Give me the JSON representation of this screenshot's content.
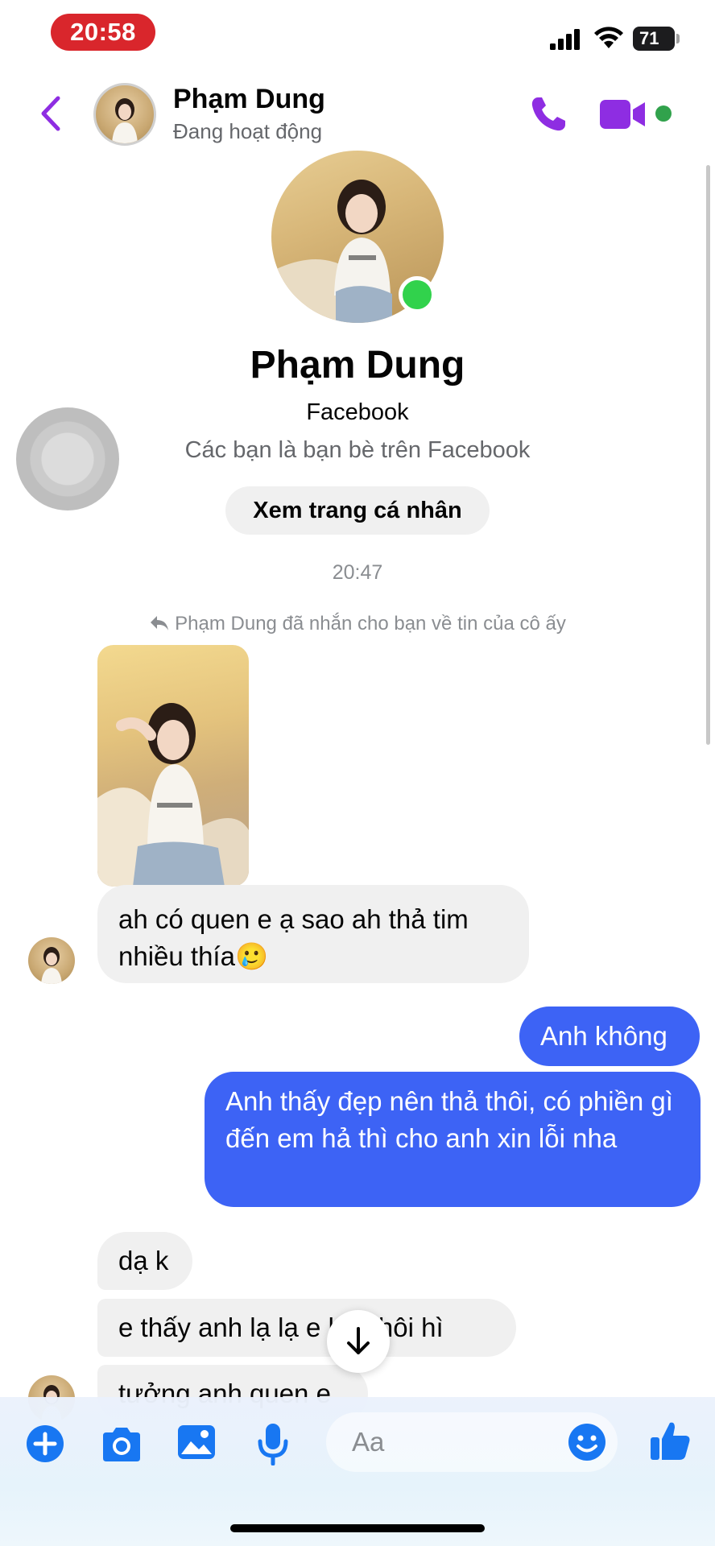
{
  "status_bar": {
    "time": "20:58",
    "battery": "71"
  },
  "header": {
    "name": "Phạm Dung",
    "status": "Đang hoạt động"
  },
  "profile": {
    "name": "Phạm Dung",
    "platform": "Facebook",
    "friends_text": "Các bạn là bạn bè trên Facebook",
    "view_profile_label": "Xem trang cá nhân"
  },
  "conversation": {
    "timestamp": "20:47",
    "story_reply_note": "Phạm Dung đã nhắn cho bạn về tin của cô ấy",
    "messages": [
      {
        "from": "them",
        "text": "ah có quen e ạ sao ah thả tim nhiều thía🥲"
      },
      {
        "from": "me",
        "text": "Anh không"
      },
      {
        "from": "me",
        "text": "Anh thấy đẹp nên thả thôi, có phiền gì đến em hả thì cho anh xin lỗi nha"
      },
      {
        "from": "them",
        "text": "dạ k"
      },
      {
        "from": "them",
        "text": "e thấy anh lạ lạ e hỏi thôi hì"
      },
      {
        "from": "them",
        "text": "tưởng anh quen e"
      }
    ]
  },
  "composer": {
    "placeholder": "Aa"
  },
  "colors": {
    "accent": "#8e2de2",
    "outgoing_bubble": "#3d63f5",
    "incoming_bubble": "#f0f0f0",
    "online": "#31a24c",
    "composer_icon": "#1877f2"
  }
}
